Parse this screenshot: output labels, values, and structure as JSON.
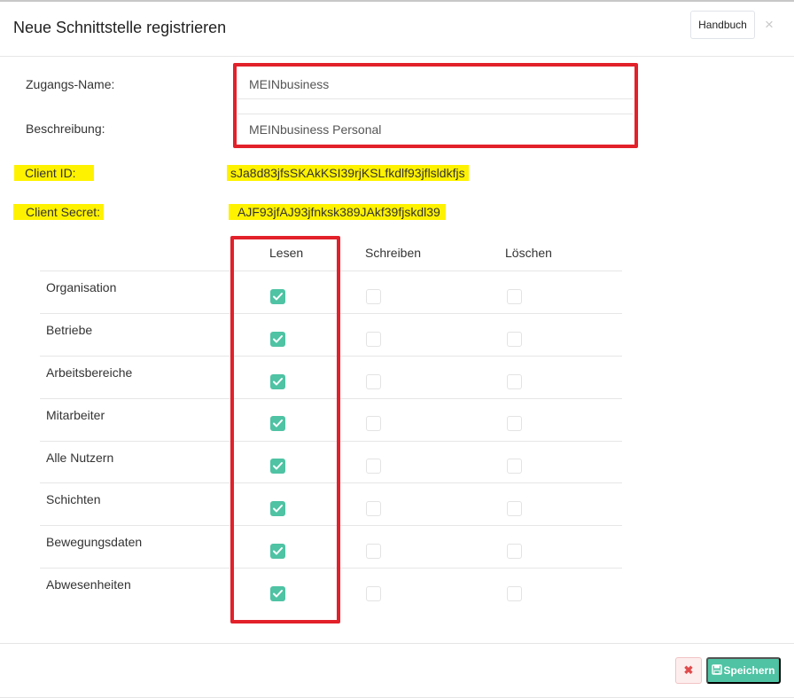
{
  "header": {
    "title": "Neue Schnittstelle registrieren",
    "manual_label": "Handbuch",
    "close_label": "×"
  },
  "form": {
    "access_name_label": "Zugangs-Name:",
    "access_name_value": "MEINbusiness",
    "description_label": "Beschreibung:",
    "description_value": "MEINbusiness Personal",
    "client_id_label": "Client ID:",
    "client_id_value": "sJa8d83jfsSKAkKSI39rjKSLfkdlf93jflsldkfjs",
    "client_secret_label": "Client Secret:",
    "client_secret_value": "AJF93jfAJ93jfnksk389JAkf39fjskdl39"
  },
  "permissions": {
    "columns": [
      "Lesen",
      "Schreiben",
      "Löschen"
    ],
    "rows": [
      {
        "label": "Organisation",
        "read": true,
        "write": false,
        "delete": false
      },
      {
        "label": "Betriebe",
        "read": true,
        "write": false,
        "delete": false
      },
      {
        "label": "Arbeitsbereiche",
        "read": true,
        "write": false,
        "delete": false
      },
      {
        "label": "Mitarbeiter",
        "read": true,
        "write": false,
        "delete": false
      },
      {
        "label": "Alle Nutzern",
        "read": true,
        "write": false,
        "delete": false
      },
      {
        "label": "Schichten",
        "read": true,
        "write": false,
        "delete": false
      },
      {
        "label": "Bewegungsdaten",
        "read": true,
        "write": false,
        "delete": false
      },
      {
        "label": "Abwesenheiten",
        "read": true,
        "write": false,
        "delete": false
      }
    ]
  },
  "footer": {
    "cancel_label": "✖",
    "save_label": "Speichern"
  },
  "colors": {
    "accent": "#4fc3a4",
    "highlight": "#fff200",
    "annotation_red": "#e2212a",
    "danger": "#e04b4b"
  }
}
